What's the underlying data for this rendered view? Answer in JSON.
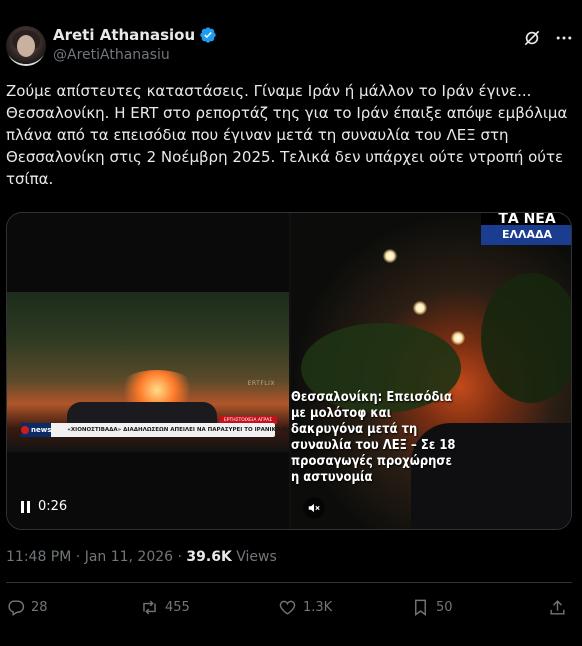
{
  "author": {
    "name": "Areti Athanasiou",
    "handle": "@AretiAthanasiu",
    "verified": true,
    "verified_color": "#1d9bf0"
  },
  "header_icons": [
    "grok-icon",
    "more-icon"
  ],
  "tweet": {
    "text": "Ζούμε απίστευτες καταστάσεις. Γίναμε Ιράν ή μάλλον το Ιράν έγινε... Θεσσαλονίκη. Η ERT στο  ρεπορτάζ της για το Ιράν έπαιξε απόψε εμβόλιμα πλάνα από τα επεισόδια που έγιναν μετά τη συναυλία του ΛΕΞ στη Θεσσαλονίκη στις 2 Νοέμβρη 2025. Τελικά δεν υπάρχει ούτε ντροπή ούτε τσίπα."
  },
  "media": {
    "video1": {
      "duration": "0:26",
      "ticker_logo": "news",
      "ticker_text": "«ΧΙΟΝΟΣΤΙΒΑΔΑ» ΔΙΑΔΗΛΩΣΕΩΝ ΑΠΕΙΛΕΙ ΝΑ ΠΑΡΑΣΥΡΕΙ ΤΟ ΙΡΑΝΙΚΟ ΚΑΘΕΣΤΩΣ",
      "ticker_caption": "ΕΡΤΗΣΤΟΙΧΕΙΑ ΑΓΡΑΣ",
      "watermark": "ERTFLIX"
    },
    "video2": {
      "brand_top": "ΤΑ ΝΕΑ",
      "brand_bottom": "ΕΛΛΑΔΑ",
      "headline": "Θεσσαλονίκη: Επεισόδια με μολότοφ και δακρυγόνα μετά τη συναυλία του ΛΕΞ – Σε 18 προσαγωγές προχώρησε η αστυνομία"
    }
  },
  "meta": {
    "time": "11:48 PM",
    "separator": "·",
    "date": "Jan 11, 2026",
    "views_count": "39.6K",
    "views_label": "Views"
  },
  "actions": {
    "replies": "28",
    "reposts": "455",
    "likes": "1.3K",
    "bookmarks": "50"
  },
  "colors": {
    "background": "#000000",
    "text": "#e7e9ea",
    "muted": "#71767b",
    "border": "#2f3336",
    "accent": "#1d9bf0"
  }
}
